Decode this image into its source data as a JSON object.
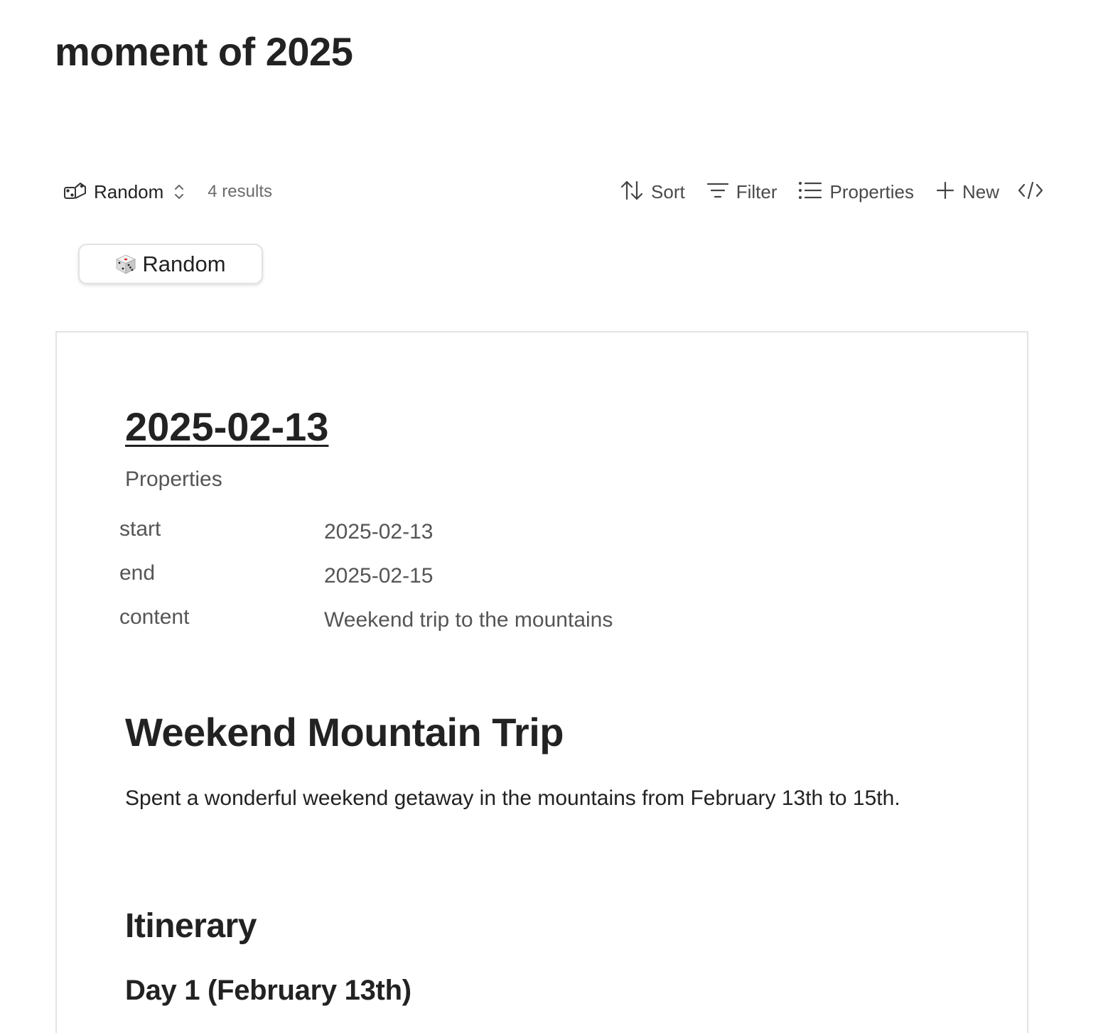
{
  "page": {
    "title": "moment of 2025"
  },
  "toolbar": {
    "view_name": "Random",
    "result_count": "4 results",
    "sort_label": "Sort",
    "filter_label": "Filter",
    "properties_label": "Properties",
    "new_label": "New"
  },
  "random_button": {
    "label": "Random",
    "icon": "dice-icon"
  },
  "entry": {
    "title": "2025-02-13",
    "properties_heading": "Properties",
    "properties": [
      {
        "key": "start",
        "value": "2025-02-13"
      },
      {
        "key": "end",
        "value": "2025-02-15"
      },
      {
        "key": "content",
        "value": "Weekend trip to the mountains"
      }
    ],
    "heading1": "Weekend Mountain Trip",
    "paragraph": "Spent a wonderful weekend getaway in the mountains from February 13th to 15th.",
    "heading2": "Itinerary",
    "heading3": "Day 1 (February 13th)"
  },
  "colors": {
    "text_primary": "#222222",
    "text_secondary": "#555555",
    "border": "#e3e3e3"
  }
}
